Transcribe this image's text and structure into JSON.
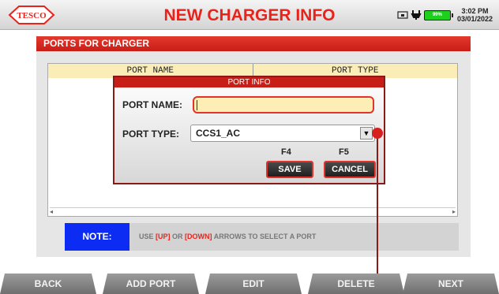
{
  "header": {
    "logo_text": "TESCO",
    "title": "NEW CHARGER INFO",
    "battery_label": "99%",
    "time": "3:02 PM",
    "date": "03/01/2022",
    "icons": [
      "usb-drive-icon",
      "power-plug-icon",
      "battery-icon"
    ],
    "title_color": "#e8231c"
  },
  "panel": {
    "title": "PORTS FOR CHARGER",
    "columns": [
      "PORT NAME",
      "PORT TYPE"
    ],
    "rows": [],
    "scroll_left": "◂",
    "scroll_right": "▸"
  },
  "dialog": {
    "title": "PORT INFO",
    "port_name_label": "PORT NAME:",
    "port_name_value": "",
    "port_type_label": "PORT TYPE:",
    "port_type_value": "CCS1_AC",
    "dropdown_arrow": "▼",
    "f4_label": "F4",
    "f5_label": "F5",
    "save_label": "SAVE",
    "cancel_label": "CANCEL"
  },
  "note": {
    "label": "NOTE:",
    "text_before": "USE ",
    "up": "[UP]",
    "text_or": " OR ",
    "down": "[DOWN]",
    "text_after": " ARROWS TO SELECT A PORT"
  },
  "nav": {
    "back": "BACK",
    "add_port": "ADD PORT",
    "edit": "EDIT",
    "delete": "DELETE",
    "next": "NEXT"
  },
  "colors": {
    "accent_red": "#e8231c",
    "note_blue": "#0c2cf4",
    "header_row": "#fbedb8"
  }
}
